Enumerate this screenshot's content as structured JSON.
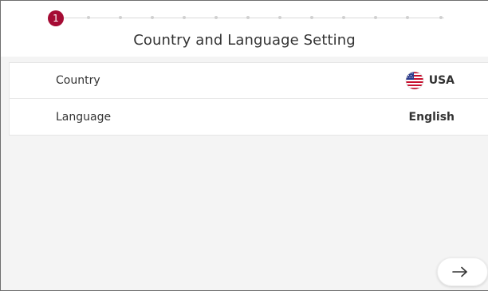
{
  "progress": {
    "current_step": "1",
    "total_steps": 13
  },
  "header": {
    "title": "Country and Language Setting"
  },
  "settings": {
    "rows": [
      {
        "label": "Country",
        "value": "USA",
        "icon": "us-flag-icon"
      },
      {
        "label": "Language",
        "value": "English"
      }
    ]
  },
  "footer": {
    "next_icon": "arrow-right-icon"
  },
  "colors": {
    "accent": "#a50b34",
    "background": "#f4f4f4",
    "panel": "#ffffff"
  }
}
